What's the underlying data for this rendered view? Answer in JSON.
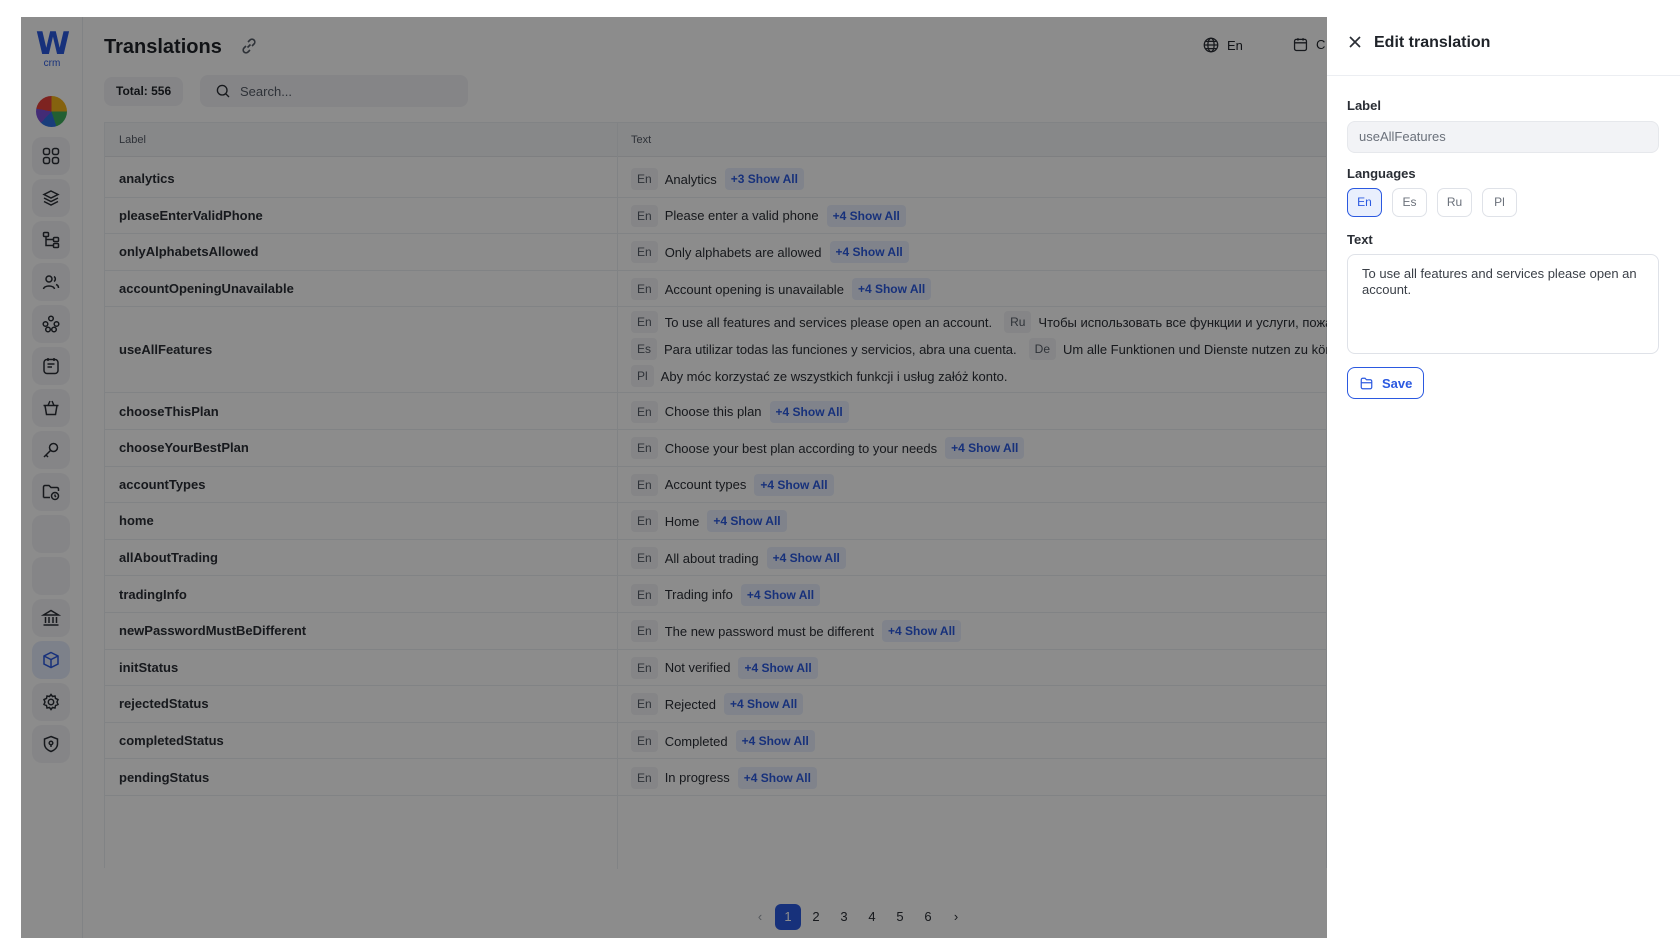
{
  "logo": {
    "mark": "W",
    "sub": "crm"
  },
  "page": {
    "title": "Translations",
    "total": "Total: 556",
    "search_placeholder": "Search..."
  },
  "topbar": {
    "language": "En",
    "calendar_partial": "C"
  },
  "table": {
    "headers": {
      "label": "Label",
      "text": "Text"
    },
    "rows": [
      {
        "label": "analytics",
        "lines": [
          [
            {
              "lang": "En",
              "text": "Analytics"
            }
          ]
        ],
        "more": "+3 Show All"
      },
      {
        "label": "pleaseEnterValidPhone",
        "lines": [
          [
            {
              "lang": "En",
              "text": "Please enter a valid phone"
            }
          ]
        ],
        "more": "+4 Show All"
      },
      {
        "label": "onlyAlphabetsAllowed",
        "lines": [
          [
            {
              "lang": "En",
              "text": "Only alphabets are allowed"
            }
          ]
        ],
        "more": "+4 Show All"
      },
      {
        "label": "accountOpeningUnavailable",
        "lines": [
          [
            {
              "lang": "En",
              "text": "Account opening is unavailable"
            }
          ]
        ],
        "more": "+4 Show All"
      },
      {
        "label": "useAllFeatures",
        "lines": [
          [
            {
              "lang": "En",
              "text": "To use all features and services please open an account."
            },
            {
              "lang": "Ru",
              "text": "Чтобы использовать все функции и услуги, пожалуйста, откройте счет."
            }
          ],
          [
            {
              "lang": "Es",
              "text": "Para utilizar todas las funciones y servicios, abra una cuenta."
            },
            {
              "lang": "De",
              "text": "Um alle Funktionen und Dienste nutzen zu können, eröffnen Sie bitte ein Konto."
            }
          ],
          [
            {
              "lang": "Pl",
              "text": "Aby móc korzystać ze wszystkich funkcji i usług załóż konto."
            }
          ]
        ],
        "more": ""
      },
      {
        "label": "chooseThisPlan",
        "lines": [
          [
            {
              "lang": "En",
              "text": "Choose this plan"
            }
          ]
        ],
        "more": "+4 Show All"
      },
      {
        "label": "chooseYourBestPlan",
        "lines": [
          [
            {
              "lang": "En",
              "text": "Choose your best plan according to your needs"
            }
          ]
        ],
        "more": "+4 Show All"
      },
      {
        "label": "accountTypes",
        "lines": [
          [
            {
              "lang": "En",
              "text": "Account types"
            }
          ]
        ],
        "more": "+4 Show All"
      },
      {
        "label": "home",
        "lines": [
          [
            {
              "lang": "En",
              "text": "Home"
            }
          ]
        ],
        "more": "+4 Show All"
      },
      {
        "label": "allAboutTrading",
        "lines": [
          [
            {
              "lang": "En",
              "text": "All about trading"
            }
          ]
        ],
        "more": "+4 Show All"
      },
      {
        "label": "tradingInfo",
        "lines": [
          [
            {
              "lang": "En",
              "text": "Trading info"
            }
          ]
        ],
        "more": "+4 Show All"
      },
      {
        "label": "newPasswordMustBeDifferent",
        "lines": [
          [
            {
              "lang": "En",
              "text": "The new password must be different"
            }
          ]
        ],
        "more": "+4 Show All"
      },
      {
        "label": "initStatus",
        "lines": [
          [
            {
              "lang": "En",
              "text": "Not verified"
            }
          ]
        ],
        "more": "+4 Show All"
      },
      {
        "label": "rejectedStatus",
        "lines": [
          [
            {
              "lang": "En",
              "text": "Rejected"
            }
          ]
        ],
        "more": "+4 Show All"
      },
      {
        "label": "completedStatus",
        "lines": [
          [
            {
              "lang": "En",
              "text": "Completed"
            }
          ]
        ],
        "more": "+4 Show All"
      },
      {
        "label": "pendingStatus",
        "lines": [
          [
            {
              "lang": "En",
              "text": "In progress"
            }
          ]
        ],
        "more": "+4 Show All"
      }
    ]
  },
  "pagination": {
    "prev": "‹",
    "next": "›",
    "pages": [
      "1",
      "2",
      "3",
      "4",
      "5",
      "6"
    ],
    "current": "1"
  },
  "drawer": {
    "title": "Edit translation",
    "label_field_label": "Label",
    "label_value": "useAllFeatures",
    "languages_label": "Languages",
    "languages": [
      "En",
      "Es",
      "Ru",
      "Pl"
    ],
    "active_language": "En",
    "text_label": "Text",
    "text_value": "To use all features and services please open an account.",
    "save_label": "Save"
  },
  "icons": {
    "sidebar": [
      "dashboard-grid-icon",
      "layers-icon",
      "hierarchy-icon",
      "users-icon",
      "network-icon",
      "notes-icon",
      "basket-icon",
      "key-icon",
      "folder-clock-icon",
      "blank-icon",
      "blank-icon",
      "bank-icon",
      "cube-icon",
      "gear-icon",
      "shield-icon"
    ]
  },
  "colors": {
    "accent": "#2b59e0",
    "overlay": "rgba(0,0,0,0.45)"
  }
}
